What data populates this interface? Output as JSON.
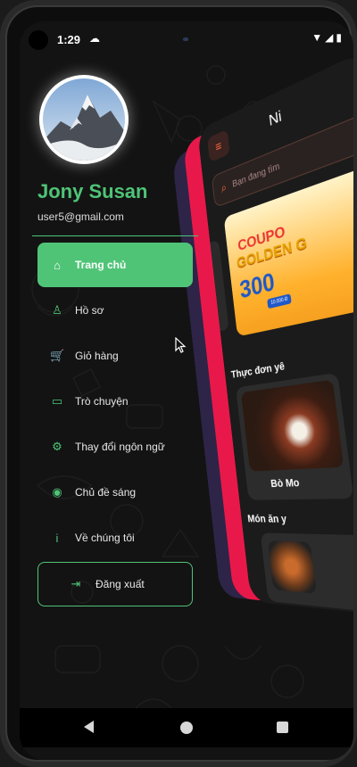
{
  "status_bar": {
    "time": "1:29",
    "cloud_icon": "cloud-icon",
    "right_icons": "▾◢▮"
  },
  "profile": {
    "name": "Jony Susan",
    "email": "user5@gmail.com"
  },
  "menu": {
    "items": [
      {
        "label": "Trang chủ",
        "icon": "home-icon",
        "glyph": "⌂",
        "active": true
      },
      {
        "label": "Hồ sơ",
        "icon": "user-icon",
        "glyph": "♙",
        "active": false
      },
      {
        "label": "Giỏ hàng",
        "icon": "cart-icon",
        "glyph": "🛒",
        "active": false
      },
      {
        "label": "Trò chuyện",
        "icon": "chat-icon",
        "glyph": "▭",
        "active": false
      },
      {
        "label": "Thay đổi ngôn ngữ",
        "icon": "gear-icon",
        "glyph": "⚙",
        "active": false
      },
      {
        "label": "Chủ đề sáng",
        "icon": "globe-icon",
        "glyph": "◉",
        "active": false
      },
      {
        "label": "Về chúng tôi",
        "icon": "info-icon",
        "glyph": "i",
        "active": false
      }
    ],
    "logout_label": "Đăng xuất",
    "logout_glyph": "⇥"
  },
  "preview": {
    "title": "Ni",
    "search_placeholder": "Bạn đang tìm",
    "coupon_line1": "COUPO",
    "coupon_line2": "GOLDEN G",
    "coupon_line3": "300",
    "coupon_badge": "10.000 Đ",
    "section1": "Thực đơn yê",
    "food1_name": "Bò Mo",
    "section2": "Món ăn y"
  },
  "colors": {
    "accent": "#4fc477",
    "background": "#131313",
    "preview_red": "#e8194a",
    "preview_purple": "#2e2447",
    "preview_orange": "#ff6a3d"
  }
}
